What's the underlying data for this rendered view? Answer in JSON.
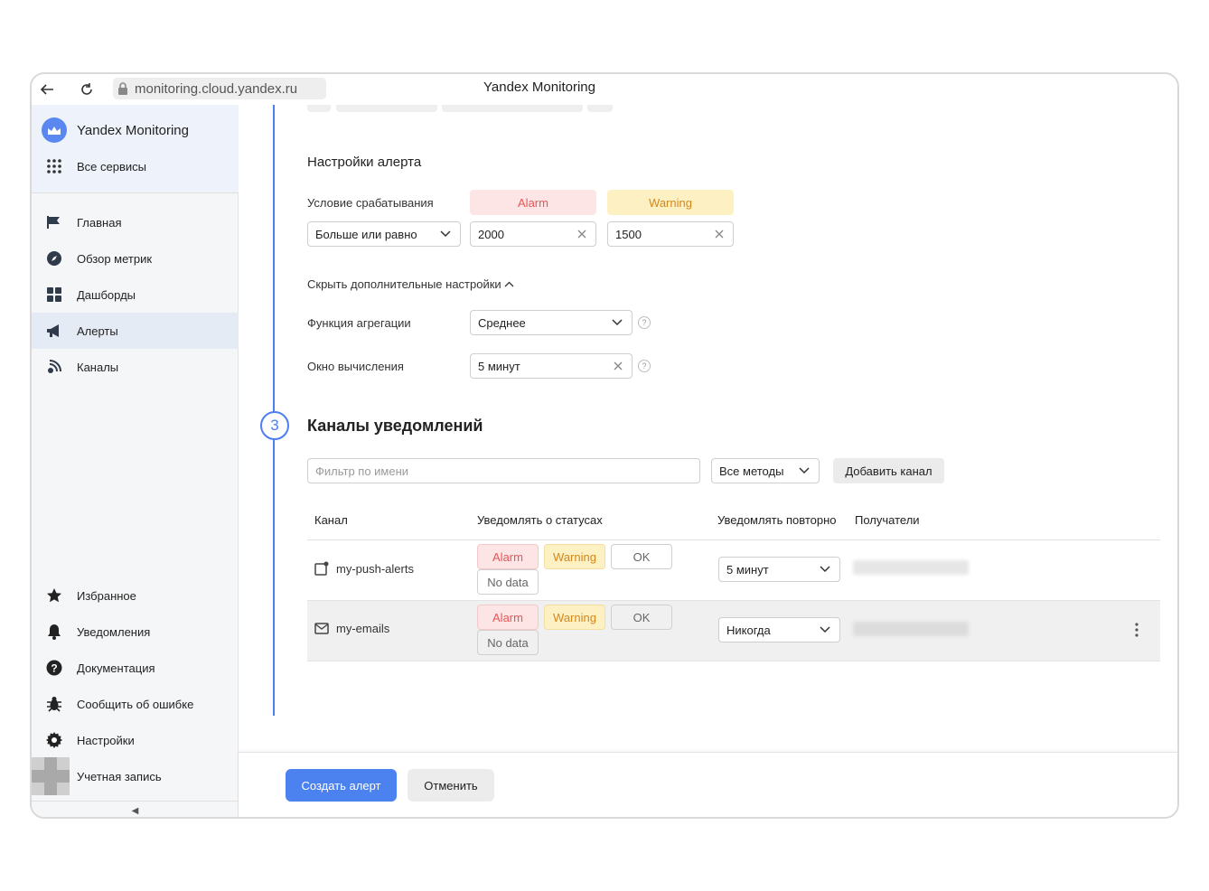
{
  "browser": {
    "url": "monitoring.cloud.yandex.ru",
    "title": "Yandex Monitoring"
  },
  "sidebar": {
    "brand": "Yandex Monitoring",
    "all_services": "Все сервисы",
    "nav": [
      {
        "label": "Главная",
        "icon": "flag-icon"
      },
      {
        "label": "Обзор метрик",
        "icon": "compass-icon"
      },
      {
        "label": "Дашборды",
        "icon": "grid-icon"
      },
      {
        "label": "Алерты",
        "icon": "megaphone-icon",
        "active": true
      },
      {
        "label": "Каналы",
        "icon": "broadcast-icon"
      }
    ],
    "bottom": [
      {
        "label": "Избранное",
        "icon": "star-icon"
      },
      {
        "label": "Уведомления",
        "icon": "bell-icon"
      },
      {
        "label": "Документация",
        "icon": "question-icon"
      },
      {
        "label": "Сообщить об ошибке",
        "icon": "bug-icon"
      },
      {
        "label": "Настройки",
        "icon": "gear-icon"
      },
      {
        "label": "Учетная запись",
        "icon": "avatar"
      }
    ],
    "collapse_glyph": "◀"
  },
  "alert_settings": {
    "title": "Настройки алерта",
    "condition_label": "Условие срабатывания",
    "alarm_label": "Alarm",
    "warning_label": "Warning",
    "comparison": "Больше или равно",
    "alarm_value": "2000",
    "warning_value": "1500",
    "hide_advanced": "Скрыть дополнительные настройки",
    "aggregation_label": "Функция агрегации",
    "aggregation_value": "Среднее",
    "window_label": "Окно вычисления",
    "window_value": "5 минут",
    "help_glyph": "?"
  },
  "channels": {
    "step_number": "3",
    "title": "Каналы уведомлений",
    "filter_placeholder": "Фильтр по имени",
    "methods_select": "Все методы",
    "add_button": "Добавить канал",
    "columns": [
      "Канал",
      "Уведомлять о статусах",
      "Уведомлять повторно",
      "Получатели"
    ],
    "rows": [
      {
        "name": "my-push-alerts",
        "icon": "push-icon",
        "statuses": {
          "alarm": "Alarm",
          "warning": "Warning",
          "ok": "OK",
          "nodata": "No data"
        },
        "repeat": "5 минут"
      },
      {
        "name": "my-emails",
        "icon": "mail-icon",
        "statuses": {
          "alarm": "Alarm",
          "warning": "Warning",
          "ok": "OK",
          "nodata": "No data"
        },
        "repeat": "Никогда"
      }
    ]
  },
  "footer": {
    "create": "Создать алерт",
    "cancel": "Отменить"
  },
  "colors": {
    "accent": "#4b82f0",
    "alarm_bg": "#fde5e5",
    "alarm_text": "#e5575a",
    "warning_bg": "#fdf0c3",
    "warning_text": "#d4881c"
  }
}
